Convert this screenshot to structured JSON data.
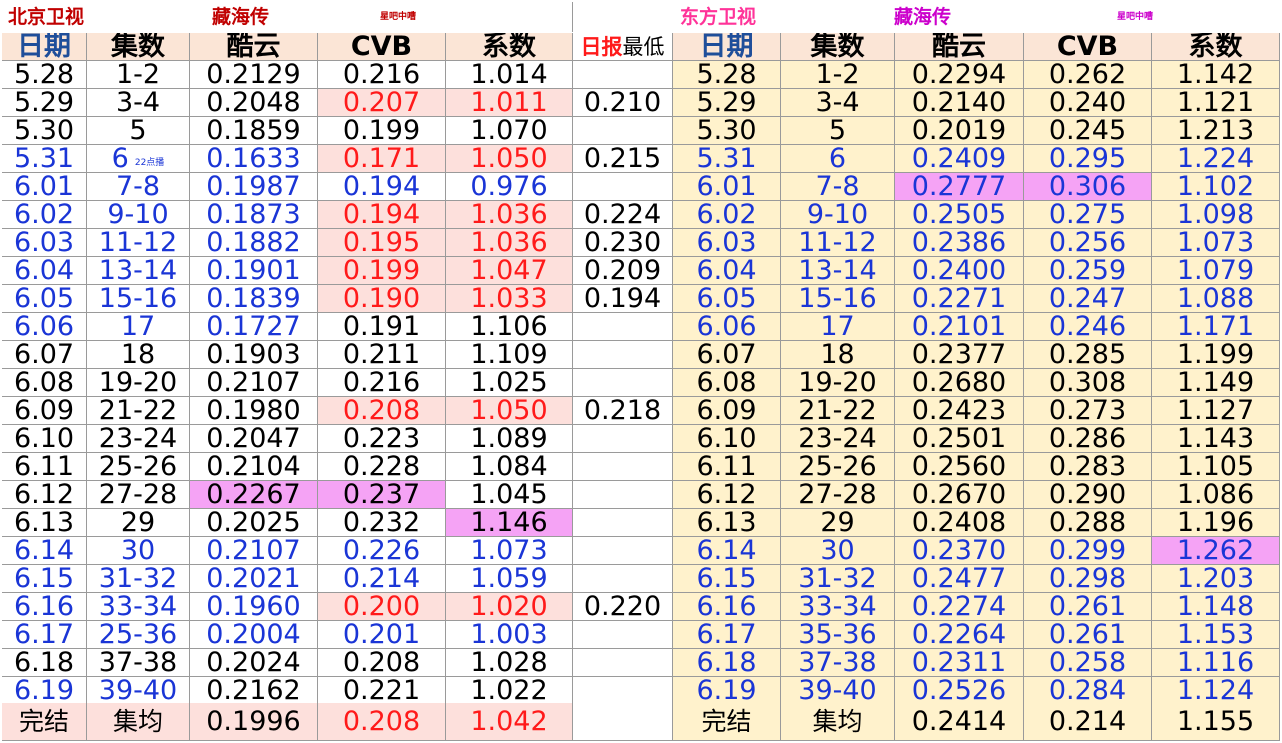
{
  "left_title": {
    "channel": "北京卫视",
    "drama": "藏海传",
    "credit": "星吧中嘈"
  },
  "right_title": {
    "channel": "东方卫视",
    "drama": "藏海传",
    "credit": "星吧中嘈"
  },
  "headers": {
    "date": "日期",
    "episodes": "集数",
    "kuyun": "酷云",
    "cvb": "CVB",
    "coef": "系数",
    "low_red": "日报",
    "low_black": "最低"
  },
  "note_22": "22点播",
  "colors": {
    "blue": "#1a35d6",
    "red": "#ff1a1a",
    "pink": "#f5a3f5",
    "header_bg": "#fbe5d6",
    "right_bg": "#fff2cc",
    "salmon": "#fde0dc"
  },
  "left_rows": [
    {
      "date": "5.28",
      "ep": "1-2",
      "kuyun": "0.2129",
      "cvb": "0.216",
      "coef": "1.014",
      "low": "",
      "style": "black"
    },
    {
      "date": "5.29",
      "ep": "3-4",
      "kuyun": "0.2048",
      "cvb": "0.207",
      "coef": "1.011",
      "low": "0.210",
      "style": "black",
      "red": true
    },
    {
      "date": "5.30",
      "ep": "5",
      "kuyun": "0.1859",
      "cvb": "0.199",
      "coef": "1.070",
      "low": "",
      "style": "black"
    },
    {
      "date": "5.31",
      "ep": "6",
      "kuyun": "0.1633",
      "cvb": "0.171",
      "coef": "1.050",
      "low": "0.215",
      "style": "blue",
      "red": true,
      "note": true
    },
    {
      "date": "6.01",
      "ep": "7-8",
      "kuyun": "0.1987",
      "cvb": "0.194",
      "coef": "0.976",
      "low": "",
      "style": "blue"
    },
    {
      "date": "6.02",
      "ep": "9-10",
      "kuyun": "0.1873",
      "cvb": "0.194",
      "coef": "1.036",
      "low": "0.224",
      "style": "blue",
      "red": true
    },
    {
      "date": "6.03",
      "ep": "11-12",
      "kuyun": "0.1882",
      "cvb": "0.195",
      "coef": "1.036",
      "low": "0.230",
      "style": "blue",
      "red": true
    },
    {
      "date": "6.04",
      "ep": "13-14",
      "kuyun": "0.1901",
      "cvb": "0.199",
      "coef": "1.047",
      "low": "0.209",
      "style": "blue",
      "red": true
    },
    {
      "date": "6.05",
      "ep": "15-16",
      "kuyun": "0.1839",
      "cvb": "0.190",
      "coef": "1.033",
      "low": "0.194",
      "style": "blue",
      "red": true
    },
    {
      "date": "6.06",
      "ep": "17",
      "kuyun": "0.1727",
      "cvb": "0.191",
      "coef": "1.106",
      "low": "",
      "style": "blue",
      "cvbBlack": true
    },
    {
      "date": "6.07",
      "ep": "18",
      "kuyun": "0.1903",
      "cvb": "0.211",
      "coef": "1.109",
      "low": "",
      "style": "black"
    },
    {
      "date": "6.08",
      "ep": "19-20",
      "kuyun": "0.2107",
      "cvb": "0.216",
      "coef": "1.025",
      "low": "",
      "style": "black"
    },
    {
      "date": "6.09",
      "ep": "21-22",
      "kuyun": "0.1980",
      "cvb": "0.208",
      "coef": "1.050",
      "low": "0.218",
      "style": "black",
      "red": true
    },
    {
      "date": "6.10",
      "ep": "23-24",
      "kuyun": "0.2047",
      "cvb": "0.223",
      "coef": "1.089",
      "low": "",
      "style": "black"
    },
    {
      "date": "6.11",
      "ep": "25-26",
      "kuyun": "0.2104",
      "cvb": "0.228",
      "coef": "1.084",
      "low": "",
      "style": "black"
    },
    {
      "date": "6.12",
      "ep": "27-28",
      "kuyun": "0.2267",
      "cvb": "0.237",
      "coef": "1.045",
      "low": "",
      "style": "black",
      "pinkKC": true
    },
    {
      "date": "6.13",
      "ep": "29",
      "kuyun": "0.2025",
      "cvb": "0.232",
      "coef": "1.146",
      "low": "",
      "style": "black",
      "pinkCoef": true
    },
    {
      "date": "6.14",
      "ep": "30",
      "kuyun": "0.2107",
      "cvb": "0.226",
      "coef": "1.073",
      "low": "",
      "style": "blue"
    },
    {
      "date": "6.15",
      "ep": "31-32",
      "kuyun": "0.2021",
      "cvb": "0.214",
      "coef": "1.059",
      "low": "",
      "style": "blue"
    },
    {
      "date": "6.16",
      "ep": "33-34",
      "kuyun": "0.1960",
      "cvb": "0.200",
      "coef": "1.020",
      "low": "0.220",
      "style": "blue",
      "red": true
    },
    {
      "date": "6.17",
      "ep": "25-36",
      "kuyun": "0.2004",
      "cvb": "0.201",
      "coef": "1.003",
      "low": "",
      "style": "blue"
    },
    {
      "date": "6.18",
      "ep": "37-38",
      "kuyun": "0.2024",
      "cvb": "0.208",
      "coef": "1.028",
      "low": "",
      "style": "black"
    },
    {
      "date": "6.19",
      "ep": "39-40",
      "kuyun": "0.2162",
      "cvb": "0.221",
      "coef": "1.022",
      "low": "",
      "style": "blue",
      "restBlack": true
    }
  ],
  "right_rows": [
    {
      "date": "5.28",
      "ep": "1-2",
      "kuyun": "0.2294",
      "cvb": "0.262",
      "coef": "1.142",
      "style": "black"
    },
    {
      "date": "5.29",
      "ep": "3-4",
      "kuyun": "0.2140",
      "cvb": "0.240",
      "coef": "1.121",
      "style": "black"
    },
    {
      "date": "5.30",
      "ep": "5",
      "kuyun": "0.2019",
      "cvb": "0.245",
      "coef": "1.213",
      "style": "black"
    },
    {
      "date": "5.31",
      "ep": "6",
      "kuyun": "0.2409",
      "cvb": "0.295",
      "coef": "1.224",
      "style": "blue"
    },
    {
      "date": "6.01",
      "ep": "7-8",
      "kuyun": "0.2777",
      "cvb": "0.306",
      "coef": "1.102",
      "style": "blue",
      "pinkKC": true
    },
    {
      "date": "6.02",
      "ep": "9-10",
      "kuyun": "0.2505",
      "cvb": "0.275",
      "coef": "1.098",
      "style": "blue"
    },
    {
      "date": "6.03",
      "ep": "11-12",
      "kuyun": "0.2386",
      "cvb": "0.256",
      "coef": "1.073",
      "style": "blue"
    },
    {
      "date": "6.04",
      "ep": "13-14",
      "kuyun": "0.2400",
      "cvb": "0.259",
      "coef": "1.079",
      "style": "blue"
    },
    {
      "date": "6.05",
      "ep": "15-16",
      "kuyun": "0.2271",
      "cvb": "0.247",
      "coef": "1.088",
      "style": "blue"
    },
    {
      "date": "6.06",
      "ep": "17",
      "kuyun": "0.2101",
      "cvb": "0.246",
      "coef": "1.171",
      "style": "blue"
    },
    {
      "date": "6.07",
      "ep": "18",
      "kuyun": "0.2377",
      "cvb": "0.285",
      "coef": "1.199",
      "style": "black"
    },
    {
      "date": "6.08",
      "ep": "19-20",
      "kuyun": "0.2680",
      "cvb": "0.308",
      "coef": "1.149",
      "style": "black"
    },
    {
      "date": "6.09",
      "ep": "21-22",
      "kuyun": "0.2423",
      "cvb": "0.273",
      "coef": "1.127",
      "style": "black"
    },
    {
      "date": "6.10",
      "ep": "23-24",
      "kuyun": "0.2501",
      "cvb": "0.286",
      "coef": "1.143",
      "style": "black"
    },
    {
      "date": "6.11",
      "ep": "25-26",
      "kuyun": "0.2560",
      "cvb": "0.283",
      "coef": "1.105",
      "style": "black"
    },
    {
      "date": "6.12",
      "ep": "27-28",
      "kuyun": "0.2670",
      "cvb": "0.290",
      "coef": "1.086",
      "style": "black"
    },
    {
      "date": "6.13",
      "ep": "29",
      "kuyun": "0.2408",
      "cvb": "0.288",
      "coef": "1.196",
      "style": "black"
    },
    {
      "date": "6.14",
      "ep": "30",
      "kuyun": "0.2370",
      "cvb": "0.299",
      "coef": "1.262",
      "style": "blue",
      "pinkCoef": true
    },
    {
      "date": "6.15",
      "ep": "31-32",
      "kuyun": "0.2477",
      "cvb": "0.298",
      "coef": "1.203",
      "style": "blue"
    },
    {
      "date": "6.16",
      "ep": "33-34",
      "kuyun": "0.2274",
      "cvb": "0.261",
      "coef": "1.148",
      "style": "blue"
    },
    {
      "date": "6.17",
      "ep": "35-36",
      "kuyun": "0.2264",
      "cvb": "0.261",
      "coef": "1.153",
      "style": "blue"
    },
    {
      "date": "6.18",
      "ep": "37-38",
      "kuyun": "0.2311",
      "cvb": "0.258",
      "coef": "1.116",
      "style": "blue"
    },
    {
      "date": "6.19",
      "ep": "39-40",
      "kuyun": "0.2526",
      "cvb": "0.284",
      "coef": "1.124",
      "style": "blue"
    }
  ],
  "left_footer": {
    "label": "完结",
    "avg": "集均",
    "kuyun": "0.1996",
    "cvb": "0.208",
    "coef": "1.042"
  },
  "right_footer": {
    "label": "完结",
    "avg": "集均",
    "kuyun": "0.2414",
    "cvb": "0.214",
    "coef": "1.155"
  }
}
